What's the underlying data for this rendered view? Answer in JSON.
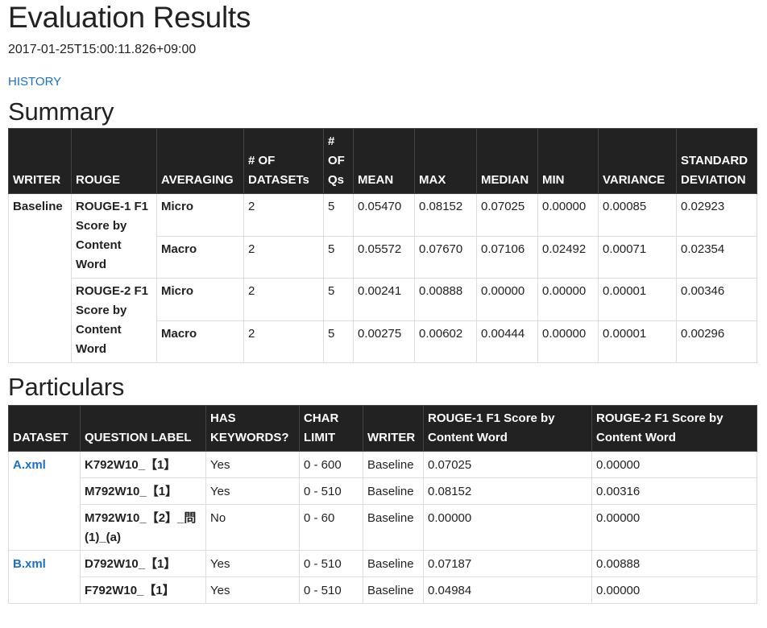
{
  "page": {
    "title": "Evaluation Results",
    "timestamp": "2017-01-25T15:00:11.826+09:00",
    "history_link": "HISTORY"
  },
  "summary": {
    "heading": "Summary",
    "columns": [
      "WRITER",
      "ROUGE",
      "AVERAGING",
      "# OF DATASETs",
      "# OF Qs",
      "MEAN",
      "MAX",
      "MEDIAN",
      "MIN",
      "VARIANCE",
      "STANDARD DEVIATION"
    ],
    "writer": "Baseline",
    "groups": [
      {
        "rouge": "ROUGE-1 F1 Score by Content Word",
        "rows": [
          {
            "averaging": "Micro",
            "datasets": "2",
            "qs": "5",
            "mean": "0.05470",
            "max": "0.08152",
            "median": "0.07025",
            "min": "0.00000",
            "variance": "0.00085",
            "stddev": "0.02923"
          },
          {
            "averaging": "Macro",
            "datasets": "2",
            "qs": "5",
            "mean": "0.05572",
            "max": "0.07670",
            "median": "0.07106",
            "min": "0.02492",
            "variance": "0.00071",
            "stddev": "0.02354"
          }
        ]
      },
      {
        "rouge": "ROUGE-2 F1 Score by Content Word",
        "rows": [
          {
            "averaging": "Micro",
            "datasets": "2",
            "qs": "5",
            "mean": "0.00241",
            "max": "0.00888",
            "median": "0.00000",
            "min": "0.00000",
            "variance": "0.00001",
            "stddev": "0.00346"
          },
          {
            "averaging": "Macro",
            "datasets": "2",
            "qs": "5",
            "mean": "0.00275",
            "max": "0.00602",
            "median": "0.00444",
            "min": "0.00000",
            "variance": "0.00001",
            "stddev": "0.00296"
          }
        ]
      }
    ]
  },
  "particulars": {
    "heading": "Particulars",
    "columns": [
      "DATASET",
      "QUESTION LABEL",
      "HAS KEYWORDS?",
      "CHAR LIMIT",
      "WRITER",
      "ROUGE-1 F1 Score by Content Word",
      "ROUGE-2 F1 Score by Content Word"
    ],
    "datasets": [
      {
        "name": "A.xml",
        "rows": [
          {
            "label": "K792W10_【1】",
            "keywords": "Yes",
            "limit": "0 - 600",
            "writer": "Baseline",
            "rouge1": "0.07025",
            "rouge2": "0.00000"
          },
          {
            "label": "M792W10_【1】",
            "keywords": "Yes",
            "limit": "0 - 510",
            "writer": "Baseline",
            "rouge1": "0.08152",
            "rouge2": "0.00316"
          },
          {
            "label": "M792W10_【2】_問(1)_(a)",
            "keywords": "No",
            "limit": "0 - 60",
            "writer": "Baseline",
            "rouge1": "0.00000",
            "rouge2": "0.00000"
          }
        ]
      },
      {
        "name": "B.xml",
        "rows": [
          {
            "label": "D792W10_【1】",
            "keywords": "Yes",
            "limit": "0 - 510",
            "writer": "Baseline",
            "rouge1": "0.07187",
            "rouge2": "0.00888"
          },
          {
            "label": "F792W10_【1】",
            "keywords": "Yes",
            "limit": "0 - 510",
            "writer": "Baseline",
            "rouge1": "0.04984",
            "rouge2": "0.00000"
          }
        ]
      }
    ]
  }
}
